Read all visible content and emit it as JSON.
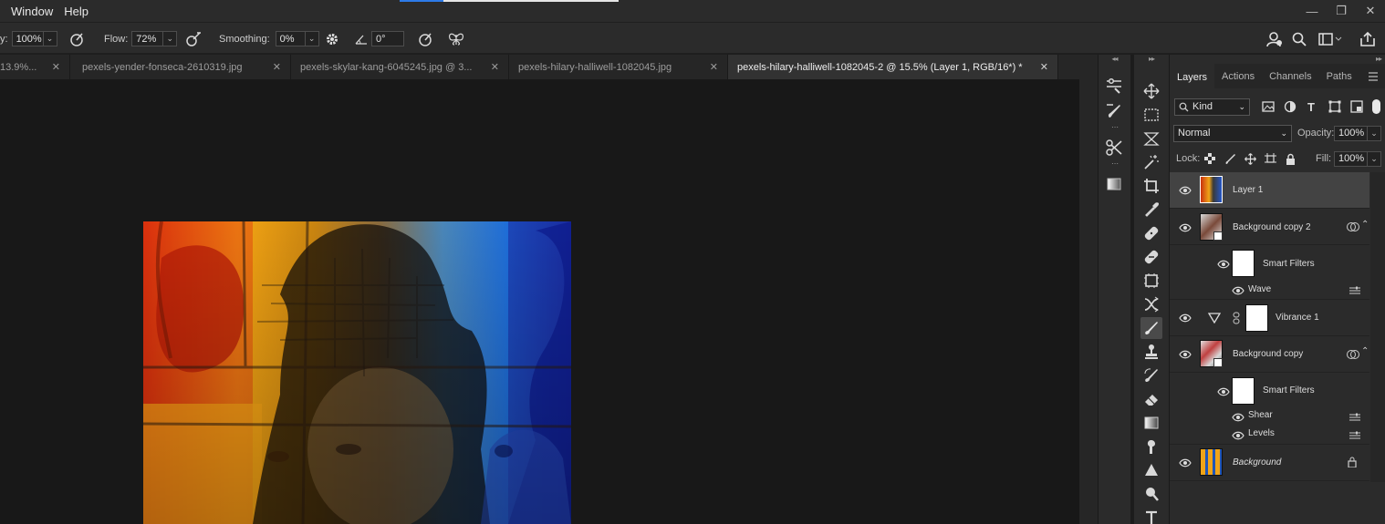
{
  "menu": {
    "items": [
      "Window",
      "Help"
    ]
  },
  "window_controls": {
    "minimize": "—",
    "restore": "❐",
    "close": "✕"
  },
  "options": {
    "opacity_label_tail": "y:",
    "opacity_value": "100%",
    "flow_label": "Flow:",
    "flow_value": "72%",
    "smoothing_label": "Smoothing:",
    "smoothing_value": "0%",
    "angle_value": "0°"
  },
  "tabs": [
    {
      "label": "13.9%..."
    },
    {
      "label": "pexels-yender-fonseca-2610319.jpg"
    },
    {
      "label": "pexels-skylar-kang-6045245.jpg @ 3..."
    },
    {
      "label": "pexels-hilary-halliwell-1082045.jpg"
    },
    {
      "label": "pexels-hilary-halliwell-1082045-2 @ 15.5% (Layer 1, RGB/16*) *",
      "active": true
    }
  ],
  "panel": {
    "tabs": [
      "Layers",
      "Actions",
      "Channels",
      "Paths"
    ],
    "filter_kind": "Kind",
    "blend_mode": "Normal",
    "opacity_label": "Opacity:",
    "opacity_value": "100%",
    "lock_label": "Lock:",
    "fill_label": "Fill:",
    "fill_value": "100%"
  },
  "layers": [
    {
      "name": "Layer 1",
      "selected": true
    },
    {
      "name": "Background copy 2"
    },
    {
      "name": "Smart Filters"
    },
    {
      "name": "Wave"
    },
    {
      "name": "Vibrance 1"
    },
    {
      "name": "Background copy"
    },
    {
      "name": "Smart Filters"
    },
    {
      "name": "Shear"
    },
    {
      "name": "Levels"
    },
    {
      "name": "Background"
    }
  ],
  "colors": {
    "accent": "#2d7be8",
    "ui_bg": "#2b2b2b",
    "canvas_bg": "#181818"
  }
}
